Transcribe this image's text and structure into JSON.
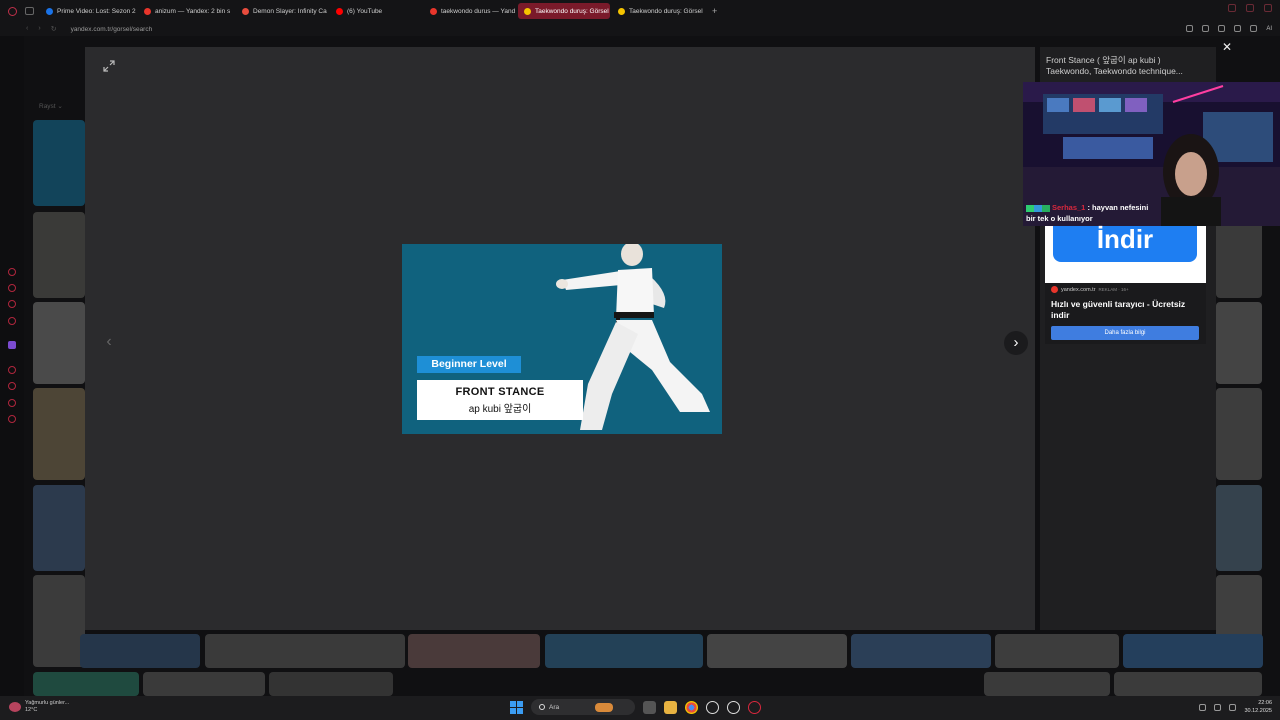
{
  "browser": {
    "tabs": [
      {
        "label": "Prime Video: Lost: Sezon 2",
        "color": "#1a73e8",
        "active": false
      },
      {
        "label": "anizum — Yandex: 2 bin s",
        "color": "#e8352b",
        "active": false
      },
      {
        "label": "Demon Slayer: Infinity Ca",
        "color": "#e84c3d",
        "active": false
      },
      {
        "label": "(6) YouTube",
        "color": "#ff0000",
        "active": false
      },
      {
        "label": "taekwondo durus — Yand",
        "color": "#e8352b",
        "active": false
      },
      {
        "label": "Taekwondo duruş: Görsel",
        "color": "#f5c400",
        "active": true
      },
      {
        "label": "Taekwondo duruş: Görsel",
        "color": "#f5c400",
        "active": false
      }
    ],
    "new_tab": "+",
    "url": "yandex.com.tr/gorsel/search",
    "ai_label": "AI"
  },
  "background": {
    "filter_label": "Rayst ⌄"
  },
  "viewer": {
    "prev_arrow": "‹",
    "next_arrow": "›",
    "close": "✕"
  },
  "image": {
    "badge": "Beginner Level",
    "stance_title": "FRONT STANCE",
    "stance_sub": "ap kubi  앞굽이"
  },
  "panel": {
    "title_line1": "Front Stance ( 앞굽이 ap kubi )",
    "title_line2": "Taekwondo, Taekwondo technique..."
  },
  "stream_chat": {
    "user": "Serhas_1",
    "message_line1": ": hayvan nefesini",
    "message_line2": "bir tek o kullanıyor"
  },
  "ad": {
    "big_button": "İndir",
    "domain": "yandex.com.tr",
    "tag": "REKLAM · 16+",
    "headline": "Hızlı ve güvenli tarayıcı - Ücretsiz indir",
    "more_button": "Daha fazla bilgi"
  },
  "taskbar": {
    "weather_line1": "Yağmurlu günler...",
    "weather_line2": "12°C",
    "search_placeholder": "Ara",
    "time": "22:06",
    "date": "30.12.2025"
  }
}
